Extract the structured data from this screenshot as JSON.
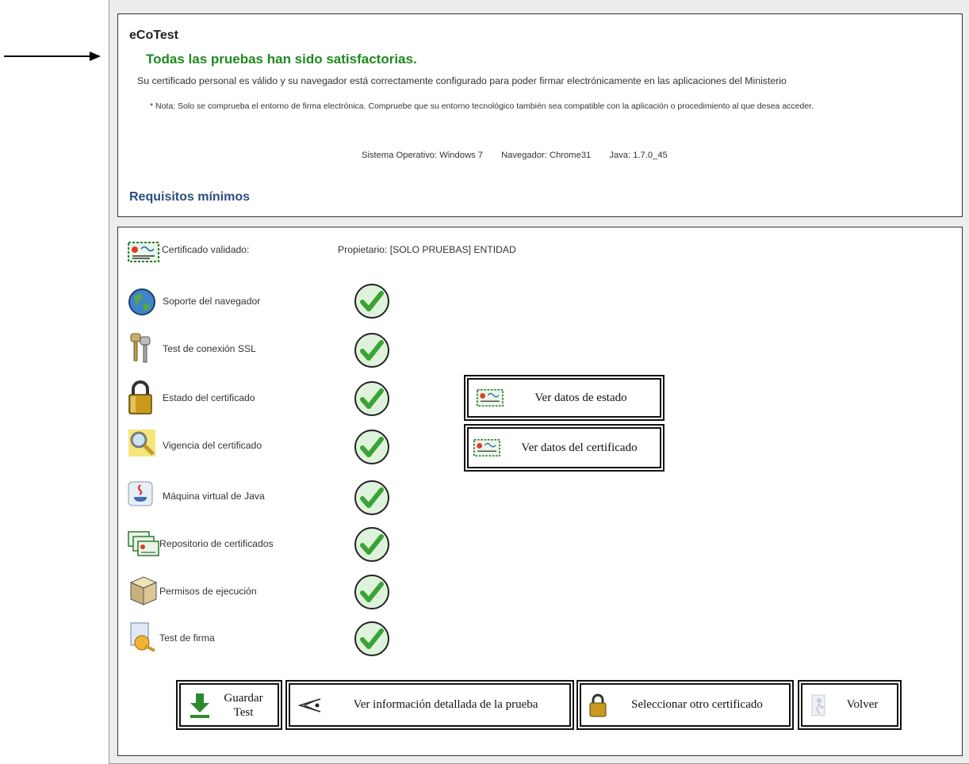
{
  "header": {
    "app_title": "eCoTest",
    "success_message": "Todas las pruebas han sido satisfactorias.",
    "info_message": "Su certificado personal es válido y su navegador está correctamente configurado para poder firmar electrónicamente en las aplicaciones del Ministerio",
    "note": "* Nota: Solo se comprueba el entorno de firma electrónica. Compruebe que su entorno tecnológico también sea compatible con la aplicación o procedimiento al que desea acceder.",
    "system": {
      "os": "Sistema Operativo: Windows 7",
      "browser": "Navegador: Chrome31",
      "java": "Java: 1.7.0_45"
    },
    "requirements_title": "Requisitos mínimos"
  },
  "certificate": {
    "label": "Certificado validado:",
    "owner": "Propietario: [SOLO PRUEBAS] ENTIDAD"
  },
  "checks": [
    {
      "label": "Soporte del navegador",
      "icon": "globe-icon",
      "status": "ok"
    },
    {
      "label": "Test de conexión SSL",
      "icon": "keys-icon",
      "status": "ok"
    },
    {
      "label": "Estado del certificado",
      "icon": "padlock-icon",
      "status": "ok"
    },
    {
      "label": "Vigencia del certificado",
      "icon": "magnifier-icon",
      "status": "ok"
    },
    {
      "label": "Máquina virtual de Java",
      "icon": "java-icon",
      "status": "ok"
    },
    {
      "label": "Repositorio de certificados",
      "icon": "certificates-icon",
      "status": "ok"
    },
    {
      "label": "Permisos de ejecución",
      "icon": "box-icon",
      "status": "ok"
    },
    {
      "label": "Test de firma",
      "icon": "signature-icon",
      "status": "ok"
    }
  ],
  "side_buttons": {
    "status_data": "Ver datos de estado",
    "certificate_data": "Ver datos del certificado"
  },
  "footer_buttons": {
    "save_line1": "Guardar",
    "save_line2": "Test",
    "details": "Ver información detallada de la prueba",
    "select_other": "Seleccionar otro certificado",
    "back": "Volver"
  },
  "colors": {
    "success": "#1f8a1f",
    "heading": "#2b4e80",
    "check_green": "#3aa335"
  }
}
